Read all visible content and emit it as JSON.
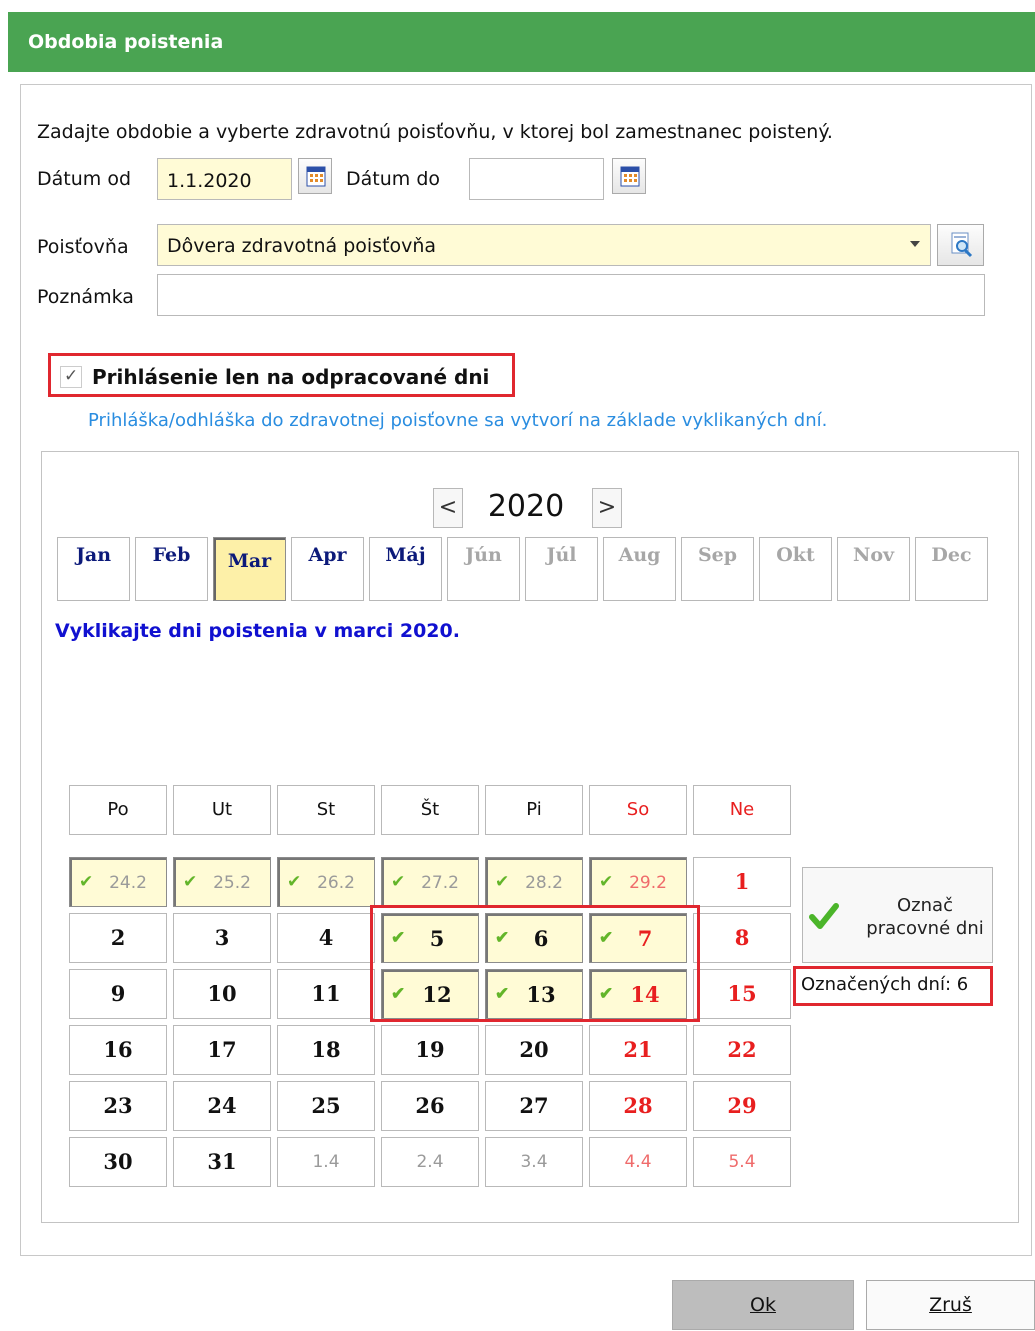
{
  "window": {
    "title": "Obdobia poistenia"
  },
  "form": {
    "instruction": "Zadajte obdobie a vyberte zdravotnú poisťovňu, v ktorej bol zamestnanec poistený.",
    "date_from_label": "Dátum od",
    "date_from_value": "1.1.2020",
    "date_to_label": "Dátum do",
    "date_to_value": "",
    "insurer_label": "Poisťovňa",
    "insurer_value": "Dôvera zdravotná poisťovňa",
    "note_label": "Poznámka",
    "note_value": "",
    "worked_days_checkbox_label": "Prihlásenie len na odpracované dni",
    "worked_days_checked": true,
    "info_text": "Prihláška/odhláška do zdravotnej poisťovne sa vytvorí na základe vyklikaných dní."
  },
  "calendar": {
    "year": "2020",
    "prev_glyph": "<",
    "next_glyph": ">",
    "months": [
      {
        "label": "Jan",
        "state": "on"
      },
      {
        "label": "Feb",
        "state": "on"
      },
      {
        "label": "Mar",
        "state": "selected"
      },
      {
        "label": "Apr",
        "state": "on"
      },
      {
        "label": "Máj",
        "state": "on"
      },
      {
        "label": "Jún",
        "state": "off"
      },
      {
        "label": "Júl",
        "state": "off"
      },
      {
        "label": "Aug",
        "state": "off"
      },
      {
        "label": "Sep",
        "state": "off"
      },
      {
        "label": "Okt",
        "state": "off"
      },
      {
        "label": "Nov",
        "state": "off"
      },
      {
        "label": "Dec",
        "state": "off"
      }
    ],
    "instruction": "Vyklikajte dni poistenia v marci 2020.",
    "weekdays": [
      "Po",
      "Ut",
      "St",
      "Št",
      "Pi",
      "So",
      "Ne"
    ],
    "weeks": [
      [
        {
          "t": "24.2",
          "other": true,
          "chk": true
        },
        {
          "t": "25.2",
          "other": true,
          "chk": true
        },
        {
          "t": "26.2",
          "other": true,
          "chk": true
        },
        {
          "t": "27.2",
          "other": true,
          "chk": true
        },
        {
          "t": "28.2",
          "other": true,
          "chk": true
        },
        {
          "t": "29.2",
          "other": true,
          "chk": true
        },
        {
          "t": "1"
        }
      ],
      [
        {
          "t": "2"
        },
        {
          "t": "3"
        },
        {
          "t": "4"
        },
        {
          "t": "5",
          "chk": true
        },
        {
          "t": "6",
          "chk": true
        },
        {
          "t": "7",
          "chk": true
        },
        {
          "t": "8"
        }
      ],
      [
        {
          "t": "9"
        },
        {
          "t": "10"
        },
        {
          "t": "11"
        },
        {
          "t": "12",
          "chk": true
        },
        {
          "t": "13",
          "chk": true
        },
        {
          "t": "14",
          "chk": true
        },
        {
          "t": "15"
        }
      ],
      [
        {
          "t": "16"
        },
        {
          "t": "17"
        },
        {
          "t": "18"
        },
        {
          "t": "19"
        },
        {
          "t": "20"
        },
        {
          "t": "21"
        },
        {
          "t": "22"
        }
      ],
      [
        {
          "t": "23"
        },
        {
          "t": "24"
        },
        {
          "t": "25"
        },
        {
          "t": "26"
        },
        {
          "t": "27"
        },
        {
          "t": "28"
        },
        {
          "t": "29"
        }
      ],
      [
        {
          "t": "30"
        },
        {
          "t": "31"
        },
        {
          "t": "1.4",
          "other": true
        },
        {
          "t": "2.4",
          "other": true
        },
        {
          "t": "3.4",
          "other": true
        },
        {
          "t": "4.4",
          "other": true
        },
        {
          "t": "5.4",
          "other": true
        }
      ]
    ],
    "mark_workdays_line1": "Označ",
    "mark_workdays_line2": "pracovné dni",
    "marked_days_text": "Označených dní: 6"
  },
  "buttons": {
    "ok": "Ok",
    "cancel": "Zruš"
  },
  "colors": {
    "title_bar": "#4aa452",
    "highlight": "#e0272f",
    "weekend": "#e81f1f",
    "link": "#2a8de0",
    "selected_cell": "#fffbd6"
  }
}
